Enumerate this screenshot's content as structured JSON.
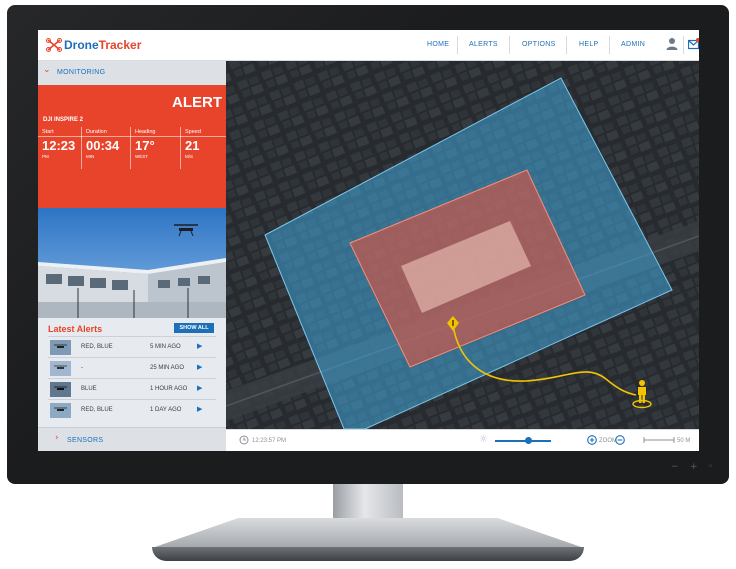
{
  "app": {
    "logo_part1": "Drone",
    "logo_part2": "Tracker"
  },
  "nav": {
    "items": [
      "HOME",
      "ALERTS",
      "OPTIONS",
      "HELP",
      "ADMIN"
    ]
  },
  "sidebar": {
    "monitoring_label": "MONITORING",
    "sensors_label": "SENSORS"
  },
  "alert_panel": {
    "title": "ALERT",
    "drone_name": "DJI INSPIRE 2",
    "stats": [
      {
        "label": "Start",
        "value": "12:23",
        "unit": "PM"
      },
      {
        "label": "Duration",
        "value": "00:34",
        "unit": "MIN"
      },
      {
        "label": "Heading",
        "value": "17°",
        "unit": "WEST"
      },
      {
        "label": "Speed",
        "value": "21",
        "unit": "M/S"
      }
    ]
  },
  "latest_alerts": {
    "title": "Latest Alerts",
    "show_all": "SHOW ALL",
    "rows": [
      {
        "colors": "RED, BLUE",
        "ago": "5 MIN AGO"
      },
      {
        "colors": "-",
        "ago": "25 MIN AGO"
      },
      {
        "colors": "BLUE",
        "ago": "1 HOUR AGO"
      },
      {
        "colors": "RED, BLUE",
        "ago": "1 DAY AGO"
      }
    ]
  },
  "toolbar": {
    "time": "12:23:57 PM",
    "zoom_label": "ZOOM",
    "scale": "50 M",
    "brightness_level": 0.6
  },
  "colors": {
    "brand_blue": "#1d6fb8",
    "alert_red": "#e8432b",
    "zone_outer": "#3fa6d8",
    "zone_inner": "#e5533d",
    "flight_path": "#f2c400"
  }
}
